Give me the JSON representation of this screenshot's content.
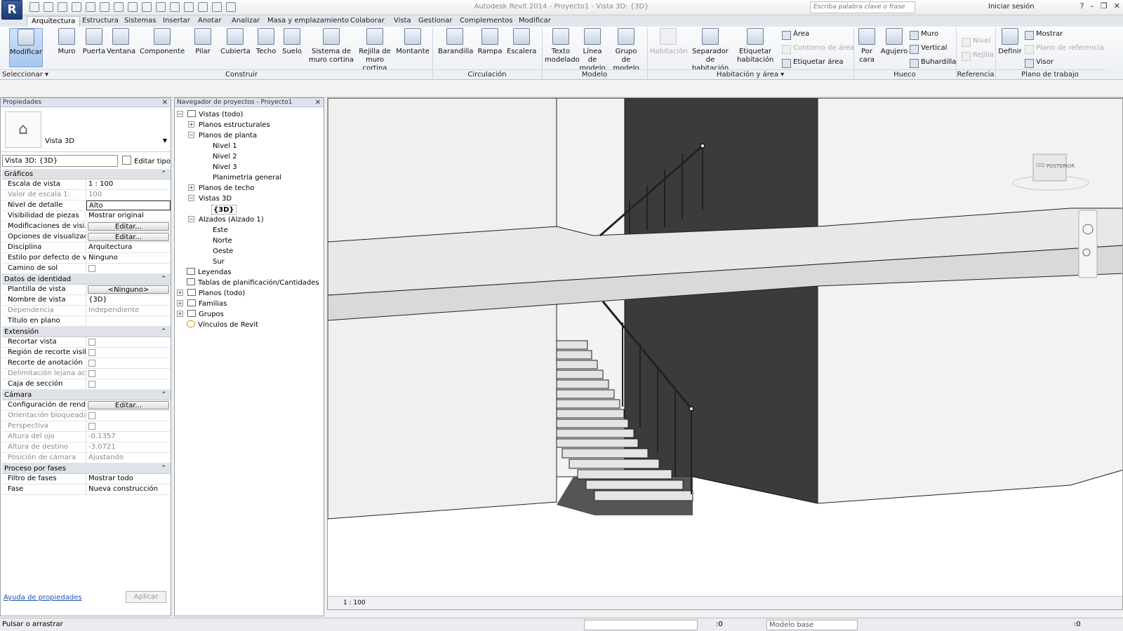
{
  "window": {
    "title": "Autodesk Revit 2014 -    Proyecto1 - Vista 3D: {3D}",
    "search_placeholder": "Escriba palabra clave o frase",
    "signin": "Iniciar sesión",
    "app_letter": "R"
  },
  "tabs": [
    "Arquitectura",
    "Estructura",
    "Sistemas",
    "Insertar",
    "Anotar",
    "Analizar",
    "Masa y emplazamiento",
    "Colaborar",
    "Vista",
    "Gestionar",
    "Complementos",
    "Modificar"
  ],
  "ribbon": {
    "modificar": "Modificar",
    "muro": "Muro",
    "puerta": "Puerta",
    "ventana": "Ventana",
    "componente": "Componente",
    "pilar": "Pilar",
    "cubierta": "Cubierta",
    "techo": "Techo",
    "suelo": "Suelo",
    "sistema1": "Sistema de",
    "sistema2": "muro cortina",
    "rejilla1": "Rejilla de",
    "rejilla2": "muro cortina",
    "montante": "Montante",
    "barandilla": "Barandilla",
    "rampa": "Rampa",
    "escalera": "Escalera",
    "texto1": "Texto",
    "texto2": "modelado",
    "linea1": "Línea de",
    "linea2": "modelo",
    "grupo1": "Grupo de",
    "grupo2": "modelo",
    "habitacion": "Habitación",
    "sep1": "Separador",
    "sep2": "de habitación",
    "etq1": "Etiquetar",
    "etq2": "habitación",
    "area": "Área",
    "contorno": "Contorno de área",
    "etq_area": "Etiquetar área",
    "porcara1": "Por",
    "porcara2": "cara",
    "agujero": "Agujero",
    "h_muro": "Muro",
    "vertical": "Vertical",
    "buhardilla": "Buhardilla",
    "nivel": "Nivel",
    "rejilla": "Rejilla",
    "definir": "Definir",
    "mostrar": "Mostrar",
    "plano_ref": "Plano de referencia",
    "visor": "Visor",
    "groups": [
      "Seleccionar ▾",
      "Construir",
      "Circulación",
      "Modelo",
      "Habitación y área ▾",
      "Hueco",
      "Referencia",
      "Plano de trabajo"
    ]
  },
  "properties": {
    "title": "Propiedades",
    "type_name": "Vista 3D",
    "instance": "Vista 3D: {3D}",
    "edit_type": "Editar tipo",
    "cat_graficos": "Gráficos",
    "cat_identidad": "Datos de identidad",
    "cat_extension": "Extensión",
    "cat_camara": "Cámara",
    "cat_fases": "Proceso por fases",
    "rows": [
      {
        "k": "Escala de vista",
        "v": "1 : 100"
      },
      {
        "k": "Valor de escala    1:",
        "v": "100"
      },
      {
        "k": "Nivel de detalle",
        "v": "Alto"
      },
      {
        "k": "Visibilidad de piezas",
        "v": "Mostrar original"
      },
      {
        "k": "Modificaciones de visi...",
        "v": "Editar..."
      },
      {
        "k": "Opciones de visualizaci...",
        "v": "Editar..."
      },
      {
        "k": "Disciplina",
        "v": "Arquitectura"
      },
      {
        "k": "Estilo por defecto de vi...",
        "v": "Ninguno"
      },
      {
        "k": "Camino de sol",
        "v": ""
      },
      {
        "k": "Plantilla de vista",
        "v": "<Ninguno>"
      },
      {
        "k": "Nombre de vista",
        "v": "{3D}"
      },
      {
        "k": "Dependencia",
        "v": "Independiente"
      },
      {
        "k": "Título en plano",
        "v": ""
      },
      {
        "k": "Recortar vista",
        "v": ""
      },
      {
        "k": "Región de recorte visible",
        "v": ""
      },
      {
        "k": "Recorte de anotación",
        "v": ""
      },
      {
        "k": "Delimitación lejana acti...",
        "v": ""
      },
      {
        "k": "Caja de sección",
        "v": ""
      },
      {
        "k": "Configuración de rend...",
        "v": "Editar..."
      },
      {
        "k": "Orientación bloqueada",
        "v": ""
      },
      {
        "k": "Perspectiva",
        "v": ""
      },
      {
        "k": "Altura del ojo",
        "v": "-0.1357"
      },
      {
        "k": "Altura de destino",
        "v": "-3.0721"
      },
      {
        "k": "Posición de cámara",
        "v": "Ajustando"
      },
      {
        "k": "Filtro de fases",
        "v": "Mostrar todo"
      },
      {
        "k": "Fase",
        "v": "Nueva construcción"
      }
    ],
    "help": "Ayuda de propiedades",
    "apply": "Aplicar"
  },
  "browser": {
    "title": "Navegador de proyectos - Proyecto1",
    "items": [
      "Vistas (todo)",
      "Planos estructurales",
      "Planos de planta",
      "Nivel 1",
      "Nivel 2",
      "Nivel 3",
      "Planimetría general",
      "Planos de techo",
      "Vistas 3D",
      "{3D}",
      "Alzados (Alzado 1)",
      "Este",
      "Norte",
      "Oeste",
      "Sur",
      "Leyendas",
      "Tablas de planificación/Cantidades",
      "Planos (todo)",
      "Familias",
      "Grupos",
      "Vínculos de Revit"
    ]
  },
  "viewport": {
    "scale": "1 : 100",
    "cube_left": "IZQ",
    "cube_back": "POSTERIOR"
  },
  "status": {
    "text": "Pulsar o arrastrar",
    "zero": ":0",
    "model": "Modelo base",
    "filter": ":0"
  },
  "colors": {
    "accent": "#1c3a72",
    "selected_tool": "#a6c7ef",
    "wall_dark": "#3a3a3a",
    "wall_light": "#f2f2f2",
    "slab": "#e7e7e7"
  }
}
